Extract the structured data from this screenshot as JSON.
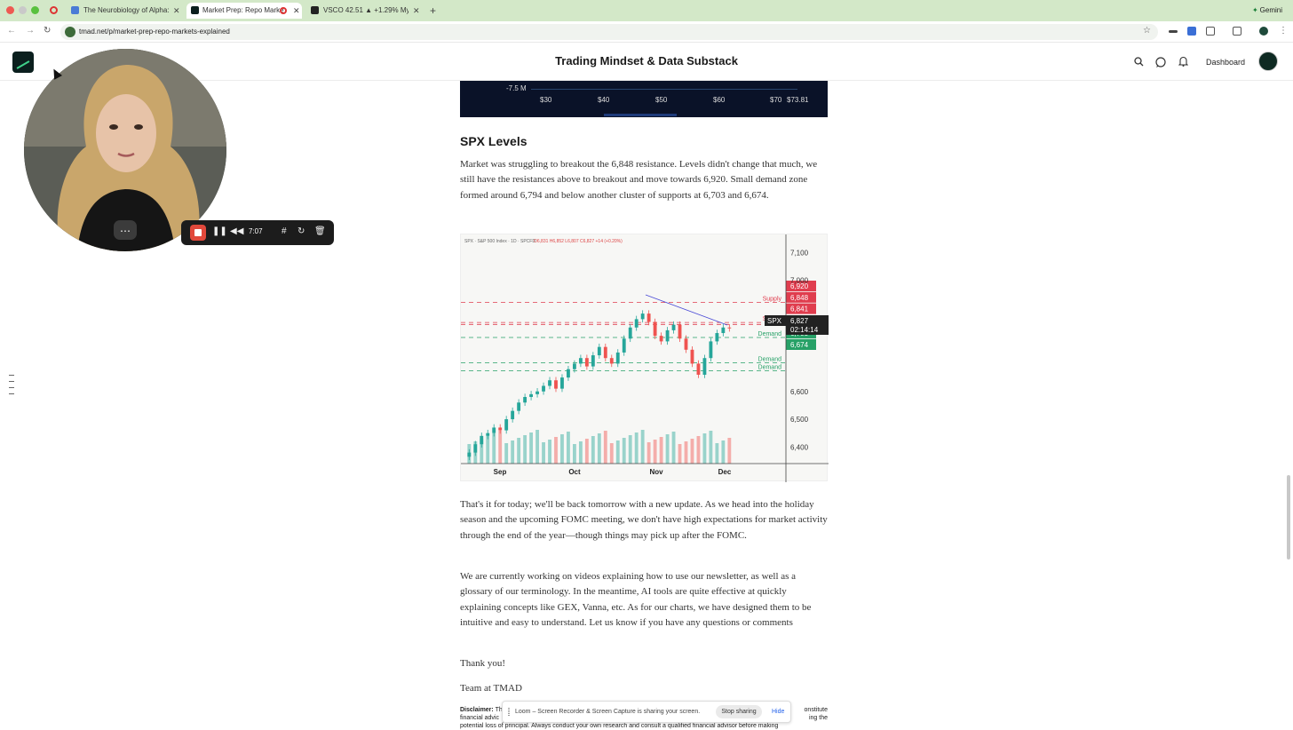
{
  "browser": {
    "tabs": [
      {
        "label": "The Neurobiology of Alpha: F",
        "active": false,
        "favicon_color": "#4a7bd6"
      },
      {
        "label": "Market Prep: Repo Marke",
        "active": true,
        "favicon_color": "#0b1f1e"
      },
      {
        "label": "VSCO 42.51 ▲ +1.29% My p",
        "active": false,
        "favicon_color": "#222222"
      }
    ],
    "new_tab": "+",
    "gemini_label": "Gemini",
    "url": "tmad.net/p/market-prep-repo-markets-explained"
  },
  "site": {
    "title": "Trading Mindset & Data Substack",
    "dashboard_label": "Dashboard"
  },
  "top_chart": {
    "y_label": "-7.5 M",
    "ticks": [
      "$30",
      "$40",
      "$50",
      "$60",
      "$70",
      "$73.81"
    ]
  },
  "article": {
    "section_title": "SPX Levels",
    "paragraph_1": "Market was struggling to breakout the 6,848 resistance. Levels didn't change that much, we still have the resistances above to breakout and move towards 6,920. Small demand zone formed around 6,794 and below another cluster of supports at 6,703 and 6,674.",
    "paragraph_2": "That's it for today; we'll be back tomorrow with a new update. As we head into the holiday season and the upcoming FOMC meeting, we don't have high expectations for market activity through the end of the year—though things may pick up after the FOMC.",
    "paragraph_3": "We are currently working on videos explaining how to use our newsletter, as well as a glossary of our terminology. In the meantime, AI tools are quite effective at quickly explaining concepts like GEX, Vanna, etc. As for our charts, we have designed them to be intuitive and easy to understand. Let us know if you have any questions or comments",
    "thanks": "Thank you!",
    "signature": "Team at TMAD",
    "disclaimer_label": "Disclaimer:",
    "disclaimer_left": "The",
    "disclaimer_line2_left": "financial advic",
    "disclaimer_line2_right": "ing the",
    "disclaimer_right": "onstitute",
    "disclaimer_line3": "potential loss of principal. Always conduct your own research and consult a qualified financial advisor before making"
  },
  "chart_data": {
    "type": "candlestick",
    "title": "SPX · S&P 500 Index · 1D · SPCFD",
    "ohlc_readout": "O6,831 H6,852 L6,807 C6,827 +14 (+0.20%)",
    "x_tick_labels": [
      "Sep",
      "Oct",
      "Nov",
      "Dec"
    ],
    "y_tick_labels": [
      "7,100",
      "7,000",
      "6,600",
      "6,500",
      "6,400"
    ],
    "ylim": [
      6350,
      7120
    ],
    "levels": [
      {
        "value": 6920,
        "label": "6,920",
        "zone": "Supply",
        "color": "#e03d4e"
      },
      {
        "value": 6848,
        "label": "6,848",
        "zone": "Supply",
        "color": "#e03d4e"
      },
      {
        "value": 6841,
        "label": "6,841",
        "zone": "",
        "color": "#e03d4e"
      },
      {
        "value": 6794,
        "label": "6,794",
        "zone": "Demand",
        "color": "#27a167"
      },
      {
        "value": 6703,
        "label": "6,703",
        "zone": "Demand",
        "color": "#27a167"
      },
      {
        "value": 6674,
        "label": "6,674",
        "zone": "Demand",
        "color": "#27a167"
      }
    ],
    "current": {
      "symbol": "SPX",
      "value": "6,827",
      "countdown": "02:14:14",
      "numeric": 6827
    },
    "closes": [
      6380,
      6410,
      6440,
      6450,
      6470,
      6460,
      6500,
      6530,
      6560,
      6580,
      6590,
      6600,
      6620,
      6640,
      6610,
      6650,
      6680,
      6700,
      6720,
      6690,
      6730,
      6760,
      6720,
      6700,
      6740,
      6790,
      6830,
      6860,
      6880,
      6850,
      6800,
      6780,
      6820,
      6840,
      6790,
      6750,
      6700,
      6660,
      6720,
      6780,
      6810,
      6830,
      6827
    ],
    "up_color": "#26a69a",
    "down_color": "#ef5350"
  },
  "recorder": {
    "time": "7:07"
  },
  "loom_banner": {
    "message": "Loom – Screen Recorder & Screen Capture is sharing your screen.",
    "stop_label": "Stop sharing",
    "hide_label": "Hide"
  }
}
